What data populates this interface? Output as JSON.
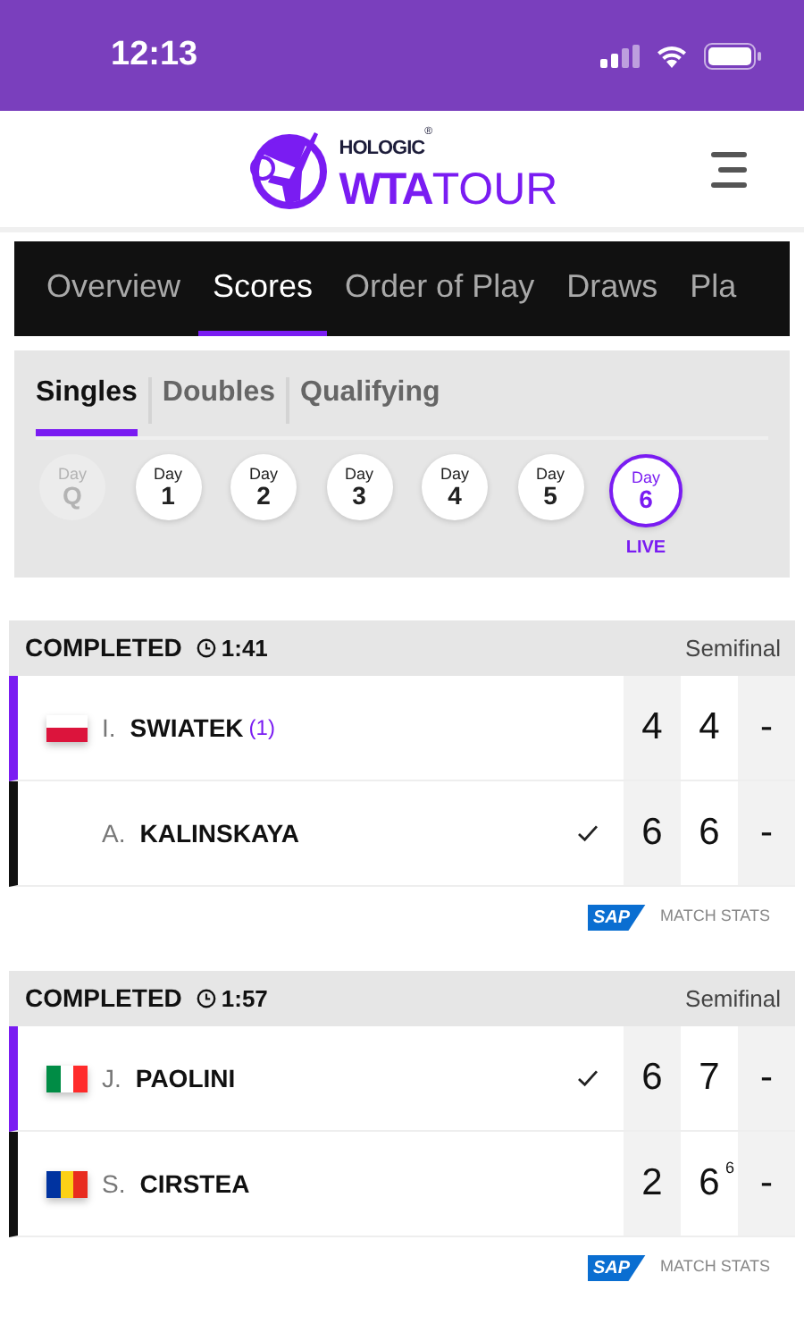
{
  "status_bar": {
    "time": "12:13"
  },
  "header": {
    "logo": {
      "brand": "HOLOGIC",
      "registered": "®",
      "wta": "WTA",
      "tour": "TOUR"
    }
  },
  "nav_tabs": [
    {
      "label": "Overview",
      "selected": false
    },
    {
      "label": "Scores",
      "selected": true
    },
    {
      "label": "Order of Play",
      "selected": false
    },
    {
      "label": "Draws",
      "selected": false
    },
    {
      "label": "Pla",
      "selected": false
    }
  ],
  "sub_tabs": [
    {
      "label": "Singles",
      "selected": true
    },
    {
      "label": "Doubles",
      "selected": false
    },
    {
      "label": "Qualifying",
      "selected": false
    }
  ],
  "days": [
    {
      "label": "Day",
      "value": "Q",
      "selected": false,
      "disabled": true
    },
    {
      "label": "Day",
      "value": "1",
      "selected": false,
      "disabled": false
    },
    {
      "label": "Day",
      "value": "2",
      "selected": false,
      "disabled": false
    },
    {
      "label": "Day",
      "value": "3",
      "selected": false,
      "disabled": false
    },
    {
      "label": "Day",
      "value": "4",
      "selected": false,
      "disabled": false
    },
    {
      "label": "Day",
      "value": "5",
      "selected": false,
      "disabled": false
    },
    {
      "label": "Day",
      "value": "6",
      "selected": true,
      "disabled": false,
      "note": "LIVE"
    }
  ],
  "matches": [
    {
      "status": "COMPLETED",
      "duration": "1:41",
      "round": "Semifinal",
      "stats_link": "MATCH STATS",
      "sponsor": "SAP",
      "players": [
        {
          "initial": "I.",
          "name": "SWIATEK",
          "seed": "(1)",
          "color": "#7a1cf2",
          "flag": {
            "kind": "horizontal",
            "stripes": [
              {
                "color": "#ffffff"
              },
              {
                "color": "#dc143c"
              }
            ]
          },
          "winner": false,
          "sets": [
            {
              "score": "4"
            },
            {
              "score": "4"
            },
            {
              "score": "-"
            }
          ]
        },
        {
          "initial": "A.",
          "name": "KALINSKAYA",
          "color": "#111111",
          "winner": true,
          "sets": [
            {
              "score": "6"
            },
            {
              "score": "6"
            },
            {
              "score": "-"
            }
          ]
        }
      ]
    },
    {
      "status": "COMPLETED",
      "duration": "1:57",
      "round": "Semifinal",
      "stats_link": "MATCH STATS",
      "sponsor": "SAP",
      "players": [
        {
          "initial": "J.",
          "name": "PAOLINI",
          "color": "#7a1cf2",
          "flag": {
            "kind": "vertical",
            "stripes": [
              {
                "color": "#008c45"
              },
              {
                "color": "#ffffff"
              },
              {
                "color": "#ff2b2b"
              }
            ]
          },
          "winner": true,
          "sets": [
            {
              "score": "6"
            },
            {
              "score": "7"
            },
            {
              "score": "-"
            }
          ]
        },
        {
          "initial": "S.",
          "name": "CIRSTEA",
          "color": "#111111",
          "flag": {
            "kind": "vertical",
            "stripes": [
              {
                "color": "#0033a0"
              },
              {
                "color": "#fcd116"
              },
              {
                "color": "#e82c1f"
              }
            ]
          },
          "winner": false,
          "sets": [
            {
              "score": "2"
            },
            {
              "score": "6",
              "tiebreak": "6"
            },
            {
              "score": "-"
            }
          ]
        }
      ]
    }
  ]
}
